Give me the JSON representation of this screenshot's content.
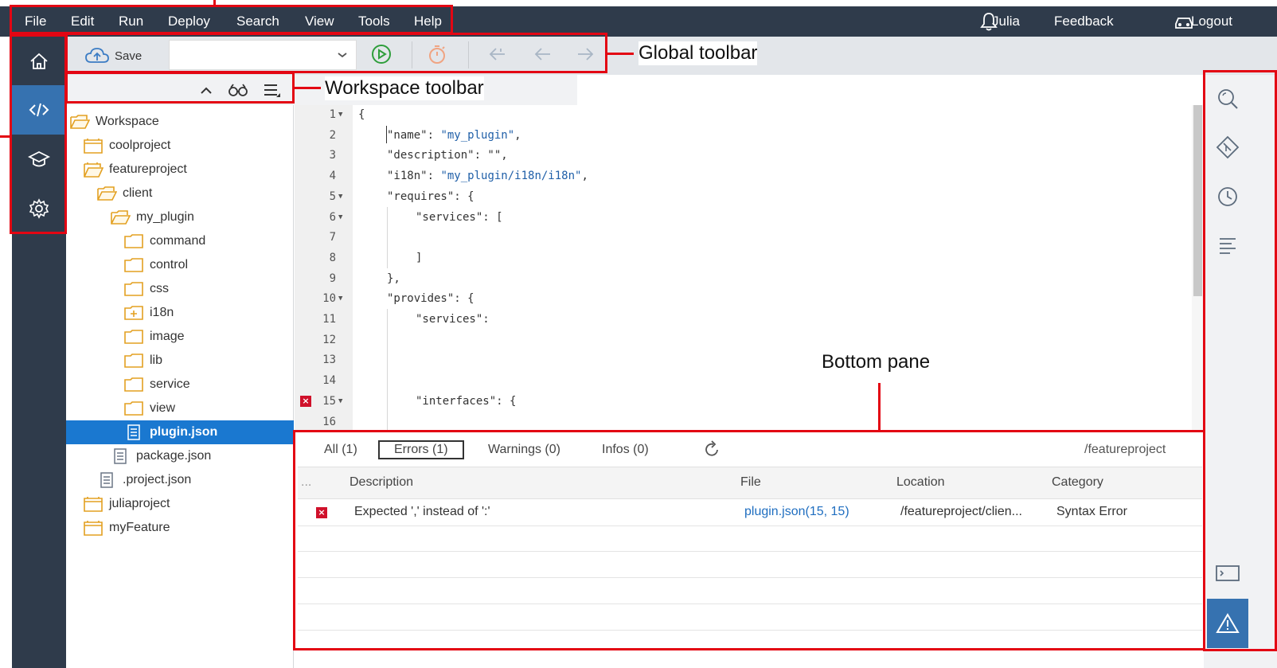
{
  "menubar": {
    "items": [
      "File",
      "Edit",
      "Run",
      "Deploy",
      "Search",
      "View",
      "Tools",
      "Help"
    ],
    "user": "Julia",
    "feedback": "Feedback",
    "logout": "Logout"
  },
  "left_nav": {
    "items": [
      "home-icon",
      "code-icon",
      "graduation-cap-icon",
      "gear-icon"
    ],
    "active": "code-icon"
  },
  "global_toolbar": {
    "save_label": "Save",
    "run_config_value": ""
  },
  "workspace": {
    "tree": [
      {
        "label": "Workspace",
        "type": "folder-open",
        "depth": 0
      },
      {
        "label": "coolproject",
        "type": "project",
        "depth": 1
      },
      {
        "label": "featureproject",
        "type": "project-open",
        "depth": 1
      },
      {
        "label": "client",
        "type": "folder-open",
        "depth": 2
      },
      {
        "label": "my_plugin",
        "type": "folder-open",
        "depth": 3
      },
      {
        "label": "command",
        "type": "folder",
        "depth": 4
      },
      {
        "label": "control",
        "type": "folder",
        "depth": 4
      },
      {
        "label": "css",
        "type": "folder",
        "depth": 4
      },
      {
        "label": "i18n",
        "type": "folder-plus",
        "depth": 4
      },
      {
        "label": "image",
        "type": "folder",
        "depth": 4
      },
      {
        "label": "lib",
        "type": "folder",
        "depth": 4
      },
      {
        "label": "service",
        "type": "folder",
        "depth": 4
      },
      {
        "label": "view",
        "type": "folder",
        "depth": 4
      },
      {
        "label": "plugin.json",
        "type": "file",
        "depth": 4,
        "selected": true
      },
      {
        "label": "package.json",
        "type": "file",
        "depth": 3
      },
      {
        "label": ".project.json",
        "type": "file",
        "depth": 2
      },
      {
        "label": "juliaproject",
        "type": "project",
        "depth": 1
      },
      {
        "label": "myFeature",
        "type": "project",
        "depth": 1
      }
    ]
  },
  "editor": {
    "lines": [
      {
        "n": "1",
        "fold": true,
        "indent": 0,
        "text": "{"
      },
      {
        "n": "2",
        "indent": 1,
        "key": "\"name\": ",
        "str": "\"my_plugin\"",
        "tail": ","
      },
      {
        "n": "3",
        "indent": 1,
        "text": "\"description\": \"\","
      },
      {
        "n": "4",
        "indent": 1,
        "key": "\"i18n\": ",
        "str": "\"my_plugin/i18n/i18n\"",
        "tail": ","
      },
      {
        "n": "5",
        "fold": true,
        "indent": 1,
        "text": "\"requires\": {"
      },
      {
        "n": "6",
        "fold": true,
        "indent": 2,
        "text": "\"services\": ["
      },
      {
        "n": "7",
        "indent": 2,
        "text": ""
      },
      {
        "n": "8",
        "indent": 2,
        "text": "]"
      },
      {
        "n": "9",
        "indent": 1,
        "text": "},"
      },
      {
        "n": "10",
        "fold": true,
        "indent": 1,
        "text": "\"provides\": {"
      },
      {
        "n": "11",
        "indent": 2,
        "text": "\"services\":"
      },
      {
        "n": "12",
        "indent": 2,
        "text": ""
      },
      {
        "n": "13",
        "indent": 2,
        "text": ""
      },
      {
        "n": "14",
        "indent": 2,
        "text": ""
      },
      {
        "n": "15",
        "fold": true,
        "error": true,
        "indent": 2,
        "text": "\"interfaces\": {"
      },
      {
        "n": "16",
        "indent": 2,
        "text": ""
      }
    ]
  },
  "problems": {
    "filters": [
      "All (1)",
      "Errors (1)",
      "Warnings (0)",
      "Infos (0)"
    ],
    "selected_filter": "Errors (1)",
    "scope": "/featureproject",
    "columns": [
      "...",
      "Description",
      "File",
      "Location",
      "Category"
    ],
    "rows": [
      {
        "severity": "error",
        "description": "Expected ',' instead of ':'",
        "file": "plugin.json(15, 15)",
        "location": "/featureproject/clien...",
        "category": "Syntax Error"
      }
    ]
  },
  "right_bar": {
    "items": [
      "search-icon",
      "git-icon",
      "history-icon",
      "outline-icon",
      "console-icon",
      "problems-icon"
    ],
    "active": "problems-icon"
  },
  "annotations": {
    "global_toolbar": "Global toolbar",
    "workspace_toolbar": "Workspace toolbar",
    "bottom_pane": "Bottom pane"
  },
  "colors": {
    "menubar": "#2f3b4b",
    "active_nav": "#3672b0",
    "selection": "#1a78d0",
    "annotation": "#e30613",
    "error": "#d0112b",
    "string": "#1f5fa8"
  }
}
